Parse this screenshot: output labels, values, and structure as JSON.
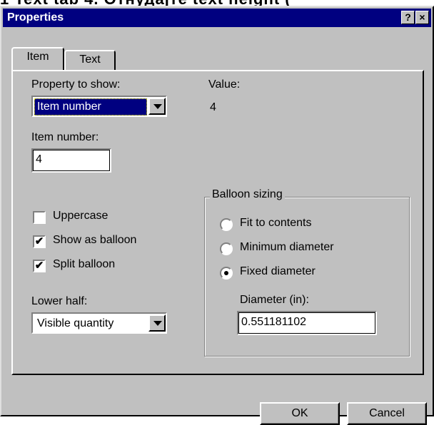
{
  "background_text": "1  Text   tab     4. Отнудајте  text  height     (",
  "window": {
    "title": "Properties",
    "help_button": "?",
    "close_button": "×"
  },
  "tabs": [
    {
      "label": "Item",
      "active": true
    },
    {
      "label": "Text",
      "active": false
    }
  ],
  "item_tab": {
    "property_to_show": {
      "label": "Property to show:",
      "selected": "Item number"
    },
    "value": {
      "label": "Value:",
      "text": "4"
    },
    "item_number": {
      "label": "Item number:",
      "value": "4"
    },
    "checkboxes": [
      {
        "label": "Uppercase",
        "checked": false
      },
      {
        "label": "Show as balloon",
        "checked": true
      },
      {
        "label": "Split balloon",
        "checked": true
      }
    ],
    "lower_half": {
      "label": "Lower half:",
      "selected": "Visible quantity"
    },
    "balloon_sizing": {
      "title": "Balloon sizing",
      "options": [
        {
          "label": "Fit to contents",
          "selected": false
        },
        {
          "label": "Minimum diameter",
          "selected": false
        },
        {
          "label": "Fixed diameter",
          "selected": true
        }
      ],
      "diameter_label": "Diameter (in):",
      "diameter_value": "0.551181102"
    }
  },
  "buttons": {
    "ok": "OK",
    "cancel": "Cancel"
  },
  "check_mark": "✔"
}
